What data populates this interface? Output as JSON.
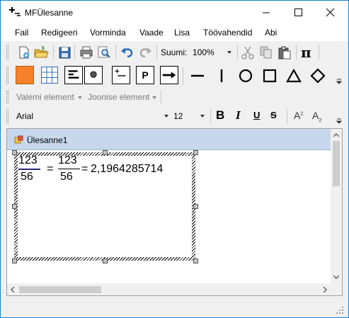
{
  "window": {
    "title": "MFÜlesanne",
    "controls": {
      "minimize": "minimize",
      "maximize": "maximize",
      "close": "close"
    }
  },
  "menu": [
    "Fail",
    "Redigeeri",
    "Vorminda",
    "Vaade",
    "Lisa",
    "Töövahendid",
    "Abi"
  ],
  "toolbar": {
    "zoom_label": "Suumi:",
    "zoom_value": "100%",
    "pi_symbol": "π"
  },
  "insert_bar": {
    "p_label": "P"
  },
  "element_bar": {
    "formula_element": "Valemi element",
    "line_element": "Joonise element"
  },
  "format_bar": {
    "font": "Arial",
    "size": "12",
    "bold": "B",
    "italic": "I",
    "underline": "U",
    "strike": "S",
    "superscript": "A",
    "subscript": "A"
  },
  "document": {
    "title": "Ülesanne1",
    "equation": {
      "frac1_num": "123",
      "frac1_den": "56",
      "eq1": "=",
      "frac2_num": "123",
      "frac2_den": "56",
      "eq2": "=",
      "result": "2,1964285714"
    }
  },
  "colors": {
    "accent_orange": "#f5822a",
    "fraction_line": "#2a2a7a",
    "child_title_bg": "#c7d8ed"
  }
}
